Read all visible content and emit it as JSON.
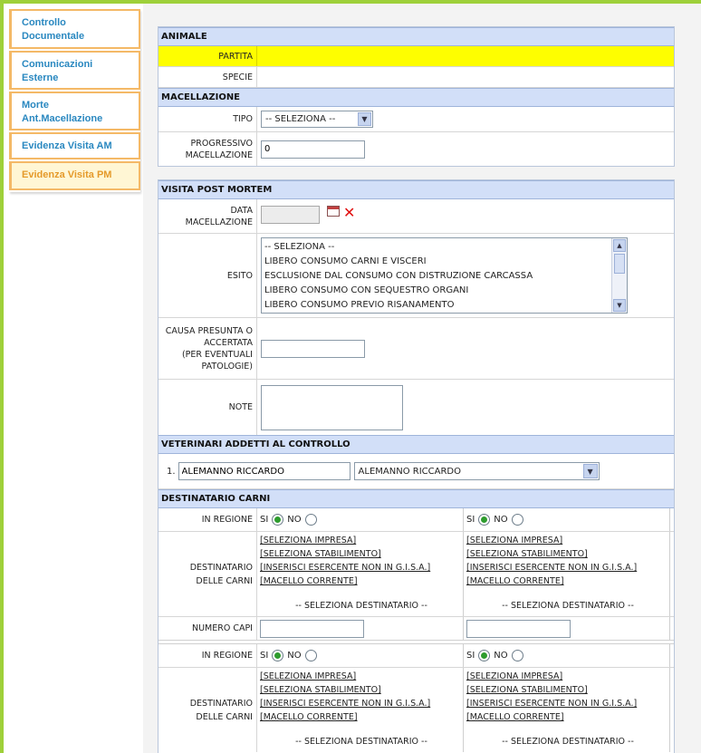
{
  "sidebar": {
    "items": [
      {
        "label_line1": "Controllo",
        "label_line2": "Documentale"
      },
      {
        "label_line1": "Comunicazioni",
        "label_line2": "Esterne"
      },
      {
        "label_line1": "Morte",
        "label_line2": "Ant.Macellazione"
      },
      {
        "label_line1": "Evidenza Visita AM",
        "label_line2": ""
      },
      {
        "label_line1": "Evidenza Visita PM",
        "label_line2": ""
      }
    ]
  },
  "animale": {
    "header": "ANIMALE",
    "partita_label": "PARTITA",
    "partita_value": "",
    "specie_label": "SPECIE",
    "specie_value": ""
  },
  "macellazione": {
    "header": "MACELLAZIONE",
    "tipo_label": "TIPO",
    "tipo_selected": "-- SELEZIONA --",
    "progressivo_label_1": "PROGRESSIVO",
    "progressivo_label_2": "MACELLAZIONE",
    "progressivo_value": "0"
  },
  "visita": {
    "header": "VISITA POST MORTEM",
    "data_label_1": "DATA",
    "data_label_2": "MACELLAZIONE",
    "data_value": "",
    "esito_label": "ESITO",
    "esito_options": [
      "-- SELEZIONA --",
      "LIBERO CONSUMO CARNI E VISCERI",
      "ESCLUSIONE DAL CONSUMO CON DISTRUZIONE CARCASSA",
      "LIBERO CONSUMO CON SEQUESTRO ORGANI",
      "LIBERO CONSUMO PREVIO RISANAMENTO"
    ],
    "causa_label_1": "CAUSA PRESUNTA O",
    "causa_label_2": "ACCERTATA",
    "causa_label_3": "(PER EVENTUALI",
    "causa_label_4": "PATOLOGIE)",
    "causa_value": "",
    "note_label": "NOTE",
    "note_value": ""
  },
  "veterinari": {
    "header": "VETERINARI ADDETTI AL CONTROLLO",
    "index": "1.",
    "name_value": "ALEMANNO RICCARDO",
    "select_selected": "ALEMANNO RICCARDO"
  },
  "destinatario": {
    "header": "DESTINATARIO CARNI",
    "in_regione_label": "IN REGIONE",
    "si_label": "SI",
    "no_label": "NO",
    "dest_label_1": "DESTINATARIO",
    "dest_label_2": "DELLE CARNI",
    "links": [
      "[SELEZIONA IMPRESA]",
      "[SELEZIONA STABILIMENTO]",
      "[INSERISCI ESERCENTE NON IN G.I.S.A.]",
      "[MACELLO CORRENTE]"
    ],
    "seleziona_destinatario": "-- SELEZIONA DESTINATARIO --",
    "numero_capi_label": "NUMERO CAPI"
  }
}
